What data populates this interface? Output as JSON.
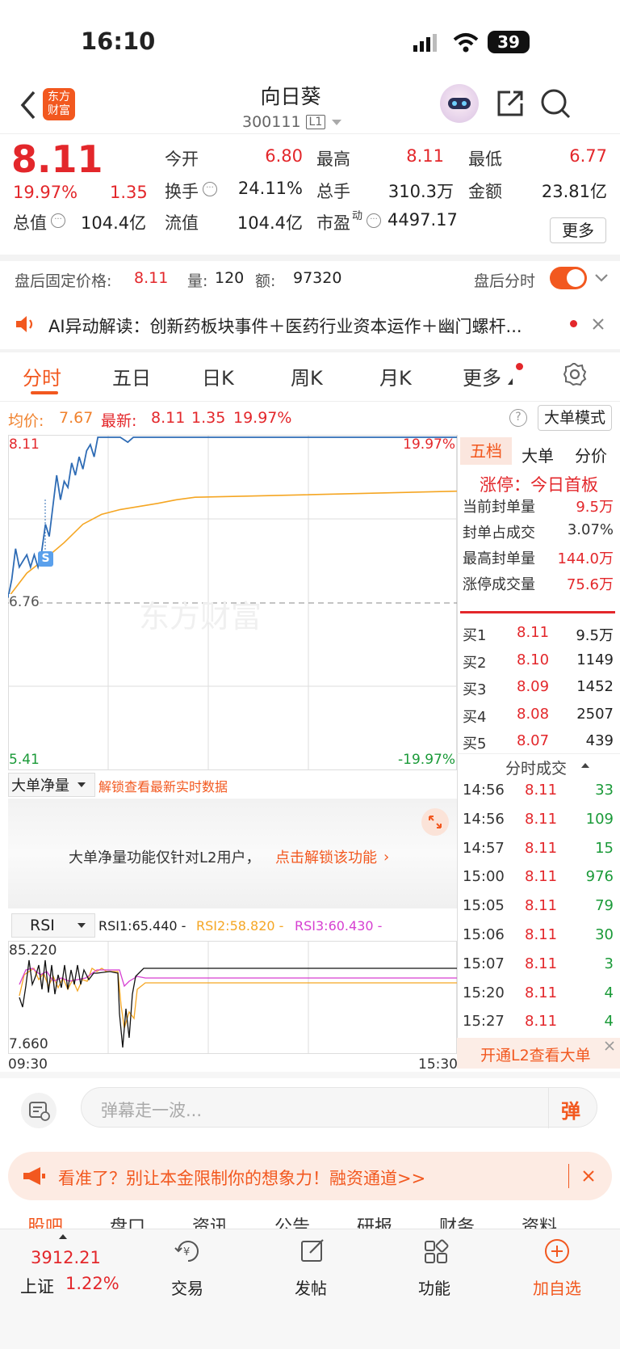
{
  "status": {
    "time": "16:10",
    "battery": "39"
  },
  "header": {
    "logo_line1": "东方",
    "logo_line2": "财富",
    "name": "向日葵",
    "code": "300111",
    "level": "L1"
  },
  "quote": {
    "price": "8.11",
    "change_pct": "19.97%",
    "change": "1.35",
    "open_label": "今开",
    "open": "6.80",
    "high_label": "最高",
    "high": "8.11",
    "low_label": "最低",
    "low": "6.77",
    "turnover_label": "换手",
    "turnover": "24.11%",
    "vol_label": "总手",
    "vol": "310.3万",
    "amt_label": "金额",
    "amt": "23.81亿",
    "mcap_label": "总值",
    "mcap": "104.4亿",
    "float_label": "流值",
    "float": "104.4亿",
    "pe_label": "市盈",
    "pe_sup": "动",
    "pe": "4497.17",
    "more_label": "更多"
  },
  "afterhours": {
    "label": "盘后固定价格:",
    "price": "8.11",
    "vol_label": "量:",
    "vol": "120",
    "amt_label": "额:",
    "amt": "97320",
    "toggle_label": "盘后分时"
  },
  "ai": {
    "text": "AI异动解读：创新药板块事件＋医药行业资本运作＋幽门螺杆..."
  },
  "tabs": [
    "分时",
    "五日",
    "日K",
    "周K",
    "月K",
    "更多"
  ],
  "avg_bar": {
    "avg_label": "均价:",
    "avg": "7.67",
    "last_label": "最新:",
    "last": "8.11",
    "chg": "1.35",
    "pct": "19.97%",
    "bigorder_mode": "大单模式"
  },
  "chart": {
    "top": "8.11",
    "mid": "6.76",
    "bottom": "5.41",
    "top_pct": "19.97%",
    "bottom_pct": "-19.97%",
    "badge": "S",
    "watermark": "东方财富"
  },
  "side_tabs": [
    "五档",
    "大单",
    "分价"
  ],
  "limit": {
    "title": "涨停：今日首板",
    "rows": [
      [
        "当前封单量",
        "9.5万"
      ],
      [
        "封单占成交",
        "3.07%"
      ],
      [
        "最高封单量",
        "144.0万"
      ],
      [
        "涨停成交量",
        "75.6万"
      ]
    ]
  },
  "bids": [
    [
      "买1",
      "8.11",
      "9.5万"
    ],
    [
      "买2",
      "8.10",
      "1149"
    ],
    [
      "买3",
      "8.09",
      "1452"
    ],
    [
      "买4",
      "8.08",
      "2507"
    ],
    [
      "买5",
      "8.07",
      "439"
    ]
  ],
  "ticks_title": "分时成交",
  "ticks": [
    [
      "14:56",
      "8.11",
      "33"
    ],
    [
      "14:56",
      "8.11",
      "109"
    ],
    [
      "14:57",
      "8.11",
      "15"
    ],
    [
      "15:00",
      "8.11",
      "976"
    ],
    [
      "15:05",
      "8.11",
      "79"
    ],
    [
      "15:06",
      "8.11",
      "30"
    ],
    [
      "15:07",
      "8.11",
      "3"
    ],
    [
      "15:20",
      "8.11",
      "4"
    ],
    [
      "15:27",
      "8.11",
      "4"
    ]
  ],
  "l2_promo": "开通L2查看大单",
  "netflow": {
    "select": "大单净量",
    "unlock": "解锁查看最新实时数据",
    "msg": "大单净量功能仅针对L2用户，",
    "link": "点击解锁该功能"
  },
  "rsi": {
    "select": "RSI",
    "r1": "RSI1:65.440 -",
    "r2": "RSI2:58.820 -",
    "r3": "RSI3:60.430 -",
    "top": "85.220",
    "bottom": "7.660",
    "t_start": "09:30",
    "t_end": "15:30"
  },
  "danmu": {
    "placeholder": "弹幕走一波...",
    "btn": "弹"
  },
  "promo": {
    "text": "看准了？别让本金限制你的想象力！融资通道>>"
  },
  "subtabs": [
    "股吧",
    "盘口",
    "资讯",
    "公告",
    "研报",
    "财务",
    "资料"
  ],
  "bottom": {
    "index_value": "3912.21",
    "index_name": "上证",
    "index_pct": "1.22%",
    "trade": "交易",
    "post": "发帖",
    "func": "功能",
    "add": "加自选"
  },
  "chart_data": {
    "type": "line",
    "x_range": [
      "09:30",
      "15:30"
    ],
    "y_range": [
      5.41,
      8.11
    ],
    "reference": 6.76,
    "series": [
      {
        "name": "最新",
        "values": [
          [
            0,
            6.8
          ],
          [
            2,
            6.95
          ],
          [
            4,
            7.2
          ],
          [
            6,
            7.05
          ],
          [
            8,
            7.1
          ],
          [
            10,
            7.15
          ],
          [
            12,
            7.05
          ],
          [
            14,
            7.15
          ],
          [
            16,
            7.05
          ],
          [
            18,
            7.18
          ],
          [
            20,
            7.4
          ],
          [
            22,
            7.3
          ],
          [
            24,
            7.55
          ],
          [
            26,
            7.8
          ],
          [
            28,
            7.6
          ],
          [
            30,
            7.75
          ],
          [
            32,
            7.7
          ],
          [
            34,
            7.9
          ],
          [
            36,
            7.8
          ],
          [
            38,
            7.95
          ],
          [
            40,
            7.85
          ],
          [
            42,
            8.0
          ],
          [
            44,
            8.05
          ],
          [
            46,
            7.95
          ],
          [
            48,
            8.11
          ],
          [
            55,
            8.11
          ],
          [
            60,
            8.11
          ],
          [
            64,
            8.07
          ],
          [
            67,
            8.11
          ],
          [
            120,
            8.11
          ],
          [
            240,
            8.11
          ]
        ]
      },
      {
        "name": "均价",
        "values": [
          [
            0,
            6.8
          ],
          [
            10,
            7.0
          ],
          [
            20,
            7.12
          ],
          [
            30,
            7.25
          ],
          [
            40,
            7.4
          ],
          [
            50,
            7.48
          ],
          [
            60,
            7.52
          ],
          [
            80,
            7.57
          ],
          [
            90,
            7.6
          ],
          [
            100,
            7.62
          ],
          [
            130,
            7.63
          ],
          [
            240,
            7.67
          ]
        ]
      }
    ]
  }
}
